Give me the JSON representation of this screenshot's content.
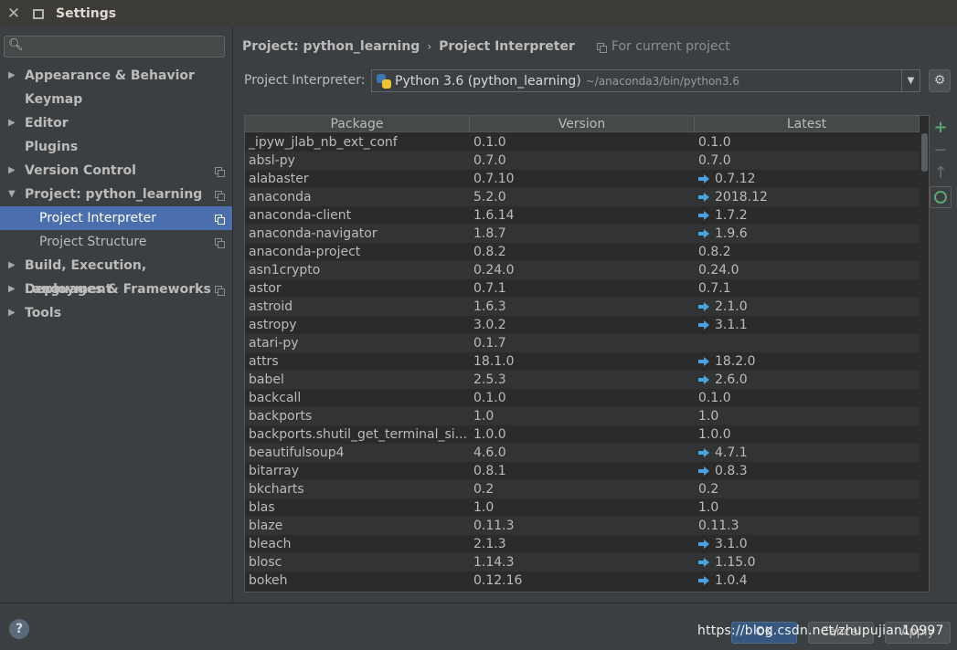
{
  "window": {
    "title": "Settings"
  },
  "search": {
    "placeholder": "",
    "value": ""
  },
  "sidebar": {
    "items": [
      {
        "label": "Appearance & Behavior",
        "expandable": true,
        "expanded": false,
        "level": 0,
        "scoped": false,
        "selected": false
      },
      {
        "label": "Keymap",
        "expandable": false,
        "level": 0,
        "scoped": false,
        "selected": false
      },
      {
        "label": "Editor",
        "expandable": true,
        "expanded": false,
        "level": 0,
        "scoped": false,
        "selected": false
      },
      {
        "label": "Plugins",
        "expandable": false,
        "level": 0,
        "scoped": false,
        "selected": false
      },
      {
        "label": "Version Control",
        "expandable": true,
        "expanded": false,
        "level": 0,
        "scoped": true,
        "selected": false
      },
      {
        "label": "Project: python_learning",
        "expandable": true,
        "expanded": true,
        "level": 0,
        "scoped": true,
        "selected": false
      },
      {
        "label": "Project Interpreter",
        "expandable": false,
        "level": 1,
        "scoped": true,
        "selected": true
      },
      {
        "label": "Project Structure",
        "expandable": false,
        "level": 1,
        "scoped": true,
        "selected": false
      },
      {
        "label": "Build, Execution, Deployment",
        "expandable": true,
        "expanded": false,
        "level": 0,
        "scoped": false,
        "selected": false
      },
      {
        "label": "Languages & Frameworks",
        "expandable": true,
        "expanded": false,
        "level": 0,
        "scoped": true,
        "selected": false
      },
      {
        "label": "Tools",
        "expandable": true,
        "expanded": false,
        "level": 0,
        "scoped": false,
        "selected": false
      }
    ]
  },
  "breadcrumb": {
    "parent": "Project: python_learning",
    "separator": "›",
    "current": "Project Interpreter",
    "scope_text": "For current project"
  },
  "interpreter": {
    "label": "Project Interpreter:",
    "name": "Python 3.6 (python_learning)",
    "path": "~/anaconda3/bin/python3.6"
  },
  "table": {
    "headers": {
      "package": "Package",
      "version": "Version",
      "latest": "Latest"
    },
    "rows": [
      {
        "package": "_ipyw_jlab_nb_ext_conf",
        "version": "0.1.0",
        "latest": "0.1.0",
        "upgrade": false
      },
      {
        "package": "absl-py",
        "version": "0.7.0",
        "latest": "0.7.0",
        "upgrade": false
      },
      {
        "package": "alabaster",
        "version": "0.7.10",
        "latest": "0.7.12",
        "upgrade": true
      },
      {
        "package": "anaconda",
        "version": "5.2.0",
        "latest": "2018.12",
        "upgrade": true
      },
      {
        "package": "anaconda-client",
        "version": "1.6.14",
        "latest": "1.7.2",
        "upgrade": true
      },
      {
        "package": "anaconda-navigator",
        "version": "1.8.7",
        "latest": "1.9.6",
        "upgrade": true
      },
      {
        "package": "anaconda-project",
        "version": "0.8.2",
        "latest": "0.8.2",
        "upgrade": false
      },
      {
        "package": "asn1crypto",
        "version": "0.24.0",
        "latest": "0.24.0",
        "upgrade": false
      },
      {
        "package": "astor",
        "version": "0.7.1",
        "latest": "0.7.1",
        "upgrade": false
      },
      {
        "package": "astroid",
        "version": "1.6.3",
        "latest": "2.1.0",
        "upgrade": true
      },
      {
        "package": "astropy",
        "version": "3.0.2",
        "latest": "3.1.1",
        "upgrade": true
      },
      {
        "package": "atari-py",
        "version": "0.1.7",
        "latest": "",
        "upgrade": false
      },
      {
        "package": "attrs",
        "version": "18.1.0",
        "latest": "18.2.0",
        "upgrade": true
      },
      {
        "package": "babel",
        "version": "2.5.3",
        "latest": "2.6.0",
        "upgrade": true
      },
      {
        "package": "backcall",
        "version": "0.1.0",
        "latest": "0.1.0",
        "upgrade": false
      },
      {
        "package": "backports",
        "version": "1.0",
        "latest": "1.0",
        "upgrade": false
      },
      {
        "package": "backports.shutil_get_terminal_si...",
        "version": "1.0.0",
        "latest": "1.0.0",
        "upgrade": false
      },
      {
        "package": "beautifulsoup4",
        "version": "4.6.0",
        "latest": "4.7.1",
        "upgrade": true
      },
      {
        "package": "bitarray",
        "version": "0.8.1",
        "latest": "0.8.3",
        "upgrade": true
      },
      {
        "package": "bkcharts",
        "version": "0.2",
        "latest": "0.2",
        "upgrade": false
      },
      {
        "package": "blas",
        "version": "1.0",
        "latest": "1.0",
        "upgrade": false
      },
      {
        "package": "blaze",
        "version": "0.11.3",
        "latest": "0.11.3",
        "upgrade": false
      },
      {
        "package": "bleach",
        "version": "2.1.3",
        "latest": "3.1.0",
        "upgrade": true
      },
      {
        "package": "blosc",
        "version": "1.14.3",
        "latest": "1.15.0",
        "upgrade": true
      },
      {
        "package": "bokeh",
        "version": "0.12.16",
        "latest": "1.0.4",
        "upgrade": true
      }
    ]
  },
  "tools": {
    "add": "+",
    "remove": "−",
    "upgrade": "↑"
  },
  "footer": {
    "help": "?",
    "ok": "OK",
    "cancel": "Cancel",
    "apply": "Apply",
    "watermark": "https://blog.csdn.net/zhupujian10997"
  },
  "colors": {
    "selection": "#4b6eaf",
    "upgrade_arrow": "#4aa3df",
    "add_green": "#59a869",
    "background": "#3c3f41",
    "table_bg": "#2b2b2b"
  }
}
